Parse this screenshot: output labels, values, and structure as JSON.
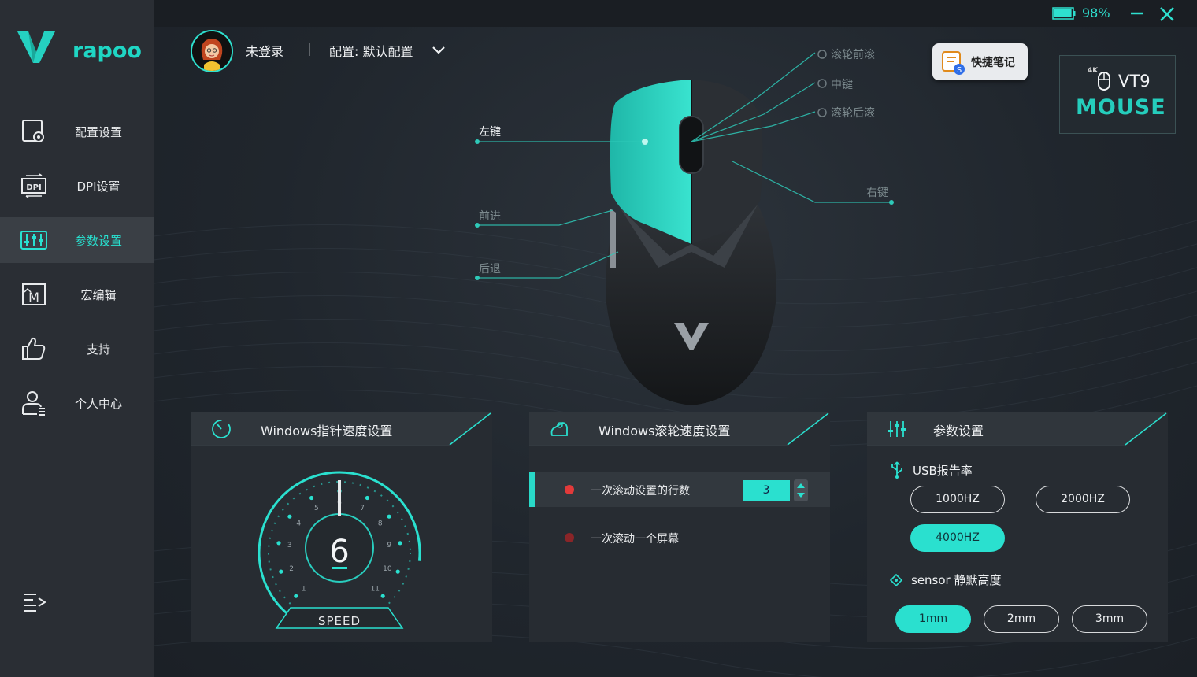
{
  "brand": {
    "name": "rapoo",
    "logo_icon": "rapoo-v-logo"
  },
  "sidebar": {
    "items": [
      {
        "label": "配置设置",
        "icon": "profile-settings-icon",
        "active": false
      },
      {
        "label": "DPI设置",
        "icon": "dpi-icon",
        "active": false
      },
      {
        "label": "参数设置",
        "icon": "parameters-icon",
        "active": true
      },
      {
        "label": "宏编辑",
        "icon": "macro-icon",
        "active": false
      },
      {
        "label": "支持",
        "icon": "thumbs-up-icon",
        "active": false
      },
      {
        "label": "个人中心",
        "icon": "user-icon",
        "active": false
      }
    ],
    "menu_icon": "menu-collapse-icon"
  },
  "topbar": {
    "battery_percent": "98%",
    "battery_level": 0.98
  },
  "header": {
    "user": "未登录",
    "separator": "|",
    "profile_label": "配置: 默认配置"
  },
  "quick_notes": {
    "label": "快捷笔记"
  },
  "model": {
    "fourk": "4K",
    "name": "VT9",
    "word": "MOUSE"
  },
  "callouts": {
    "left_button": "左键",
    "forward": "前进",
    "back": "后退",
    "scroll_up": "滚轮前滚",
    "middle": "中键",
    "scroll_down": "滚轮后滚",
    "right_button": "右键"
  },
  "pointer_panel": {
    "title": "Windows指针速度设置",
    "value": "6",
    "speed_label": "SPEED",
    "scale": [
      "1",
      "2",
      "3",
      "4",
      "5",
      "6",
      "7",
      "8",
      "9",
      "10",
      "11"
    ]
  },
  "scroll_panel": {
    "title": "Windows滚轮速度设置",
    "option_lines": "一次滚动设置的行数",
    "lines_value": "3",
    "option_screen": "一次滚动一个屏幕"
  },
  "params_panel": {
    "title": "参数设置",
    "usb_label": "USB报告率",
    "polling_rates": [
      "1000HZ",
      "2000HZ",
      "4000HZ"
    ],
    "polling_selected": "4000HZ",
    "lod_label": "sensor 静默高度",
    "lod_options": [
      "1mm",
      "2mm",
      "3mm"
    ],
    "lod_selected": "1mm"
  },
  "colors": {
    "accent": "#2ae0cf",
    "sidebar": "#2a2e34",
    "panel": "#272c32"
  }
}
